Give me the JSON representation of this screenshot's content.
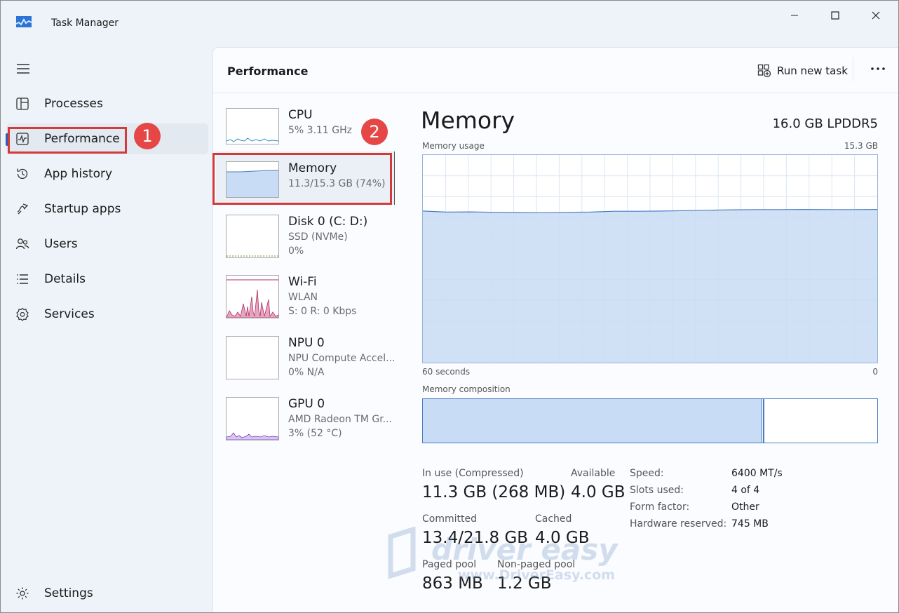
{
  "window": {
    "title": "Task Manager"
  },
  "sidebar": {
    "items": [
      {
        "label": "Processes",
        "icon": "processes-icon"
      },
      {
        "label": "Performance",
        "icon": "performance-icon",
        "selected": true
      },
      {
        "label": "App history",
        "icon": "history-icon"
      },
      {
        "label": "Startup apps",
        "icon": "startup-icon"
      },
      {
        "label": "Users",
        "icon": "users-icon"
      },
      {
        "label": "Details",
        "icon": "details-icon"
      },
      {
        "label": "Services",
        "icon": "services-icon"
      }
    ],
    "settings_label": "Settings"
  },
  "annotations": {
    "step1": "1",
    "step2": "2"
  },
  "header": {
    "title": "Performance",
    "run_new_task": "Run new task"
  },
  "resources": [
    {
      "name": "CPU",
      "line1": "5% 3.11 GHz",
      "line2": ""
    },
    {
      "name": "Memory",
      "line1": "11.3/15.3 GB (74%)",
      "line2": "",
      "selected": true
    },
    {
      "name": "Disk 0 (C: D:)",
      "line1": "SSD (NVMe)",
      "line2": "0%"
    },
    {
      "name": "Wi-Fi",
      "line1": "WLAN",
      "line2": "S: 0 R: 0 Kbps"
    },
    {
      "name": "NPU 0",
      "line1": "NPU Compute Accel...",
      "line2": "0% N/A"
    },
    {
      "name": "GPU 0",
      "line1": "AMD Radeon TM Gr...",
      "line2": "3% (52 °C)"
    }
  ],
  "detail": {
    "title": "Memory",
    "spec": "16.0 GB LPDDR5",
    "usage_label": "Memory usage",
    "usage_max": "15.3 GB",
    "axis_left": "60 seconds",
    "axis_right": "0",
    "composition_label": "Memory composition",
    "composition_used_fraction": 0.745,
    "stats": {
      "in_use_label": "In use (Compressed)",
      "in_use_value": "11.3 GB (268 MB)",
      "available_label": "Available",
      "available_value": "4.0 GB",
      "committed_label": "Committed",
      "committed_value": "13.4/21.8 GB",
      "cached_label": "Cached",
      "cached_value": "4.0 GB",
      "paged_label": "Paged pool",
      "paged_value": "863 MB",
      "nonpaged_label": "Non-paged pool",
      "nonpaged_value": "1.2 GB"
    },
    "specs": [
      {
        "label": "Speed:",
        "value": "6400 MT/s"
      },
      {
        "label": "Slots used:",
        "value": "4 of 4"
      },
      {
        "label": "Form factor:",
        "value": "Other"
      },
      {
        "label": "Hardware reserved:",
        "value": "745 MB"
      }
    ]
  },
  "usage_history": [
    73.0,
    72.5,
    72.6,
    72.4,
    72.3,
    72.2,
    72.4,
    72.5,
    72.9,
    72.9,
    73.0,
    73.2,
    73.4,
    73.6,
    73.7,
    73.7,
    73.8,
    73.7,
    73.7,
    73.8
  ],
  "watermark": {
    "brand": "driver easy",
    "url": "www.DriverEasy.com"
  },
  "colors": {
    "accent": "#2a5fb8",
    "annotation": "#e54747",
    "memory_fill": "#c8dcf5",
    "memory_line": "#4b7fc1"
  }
}
